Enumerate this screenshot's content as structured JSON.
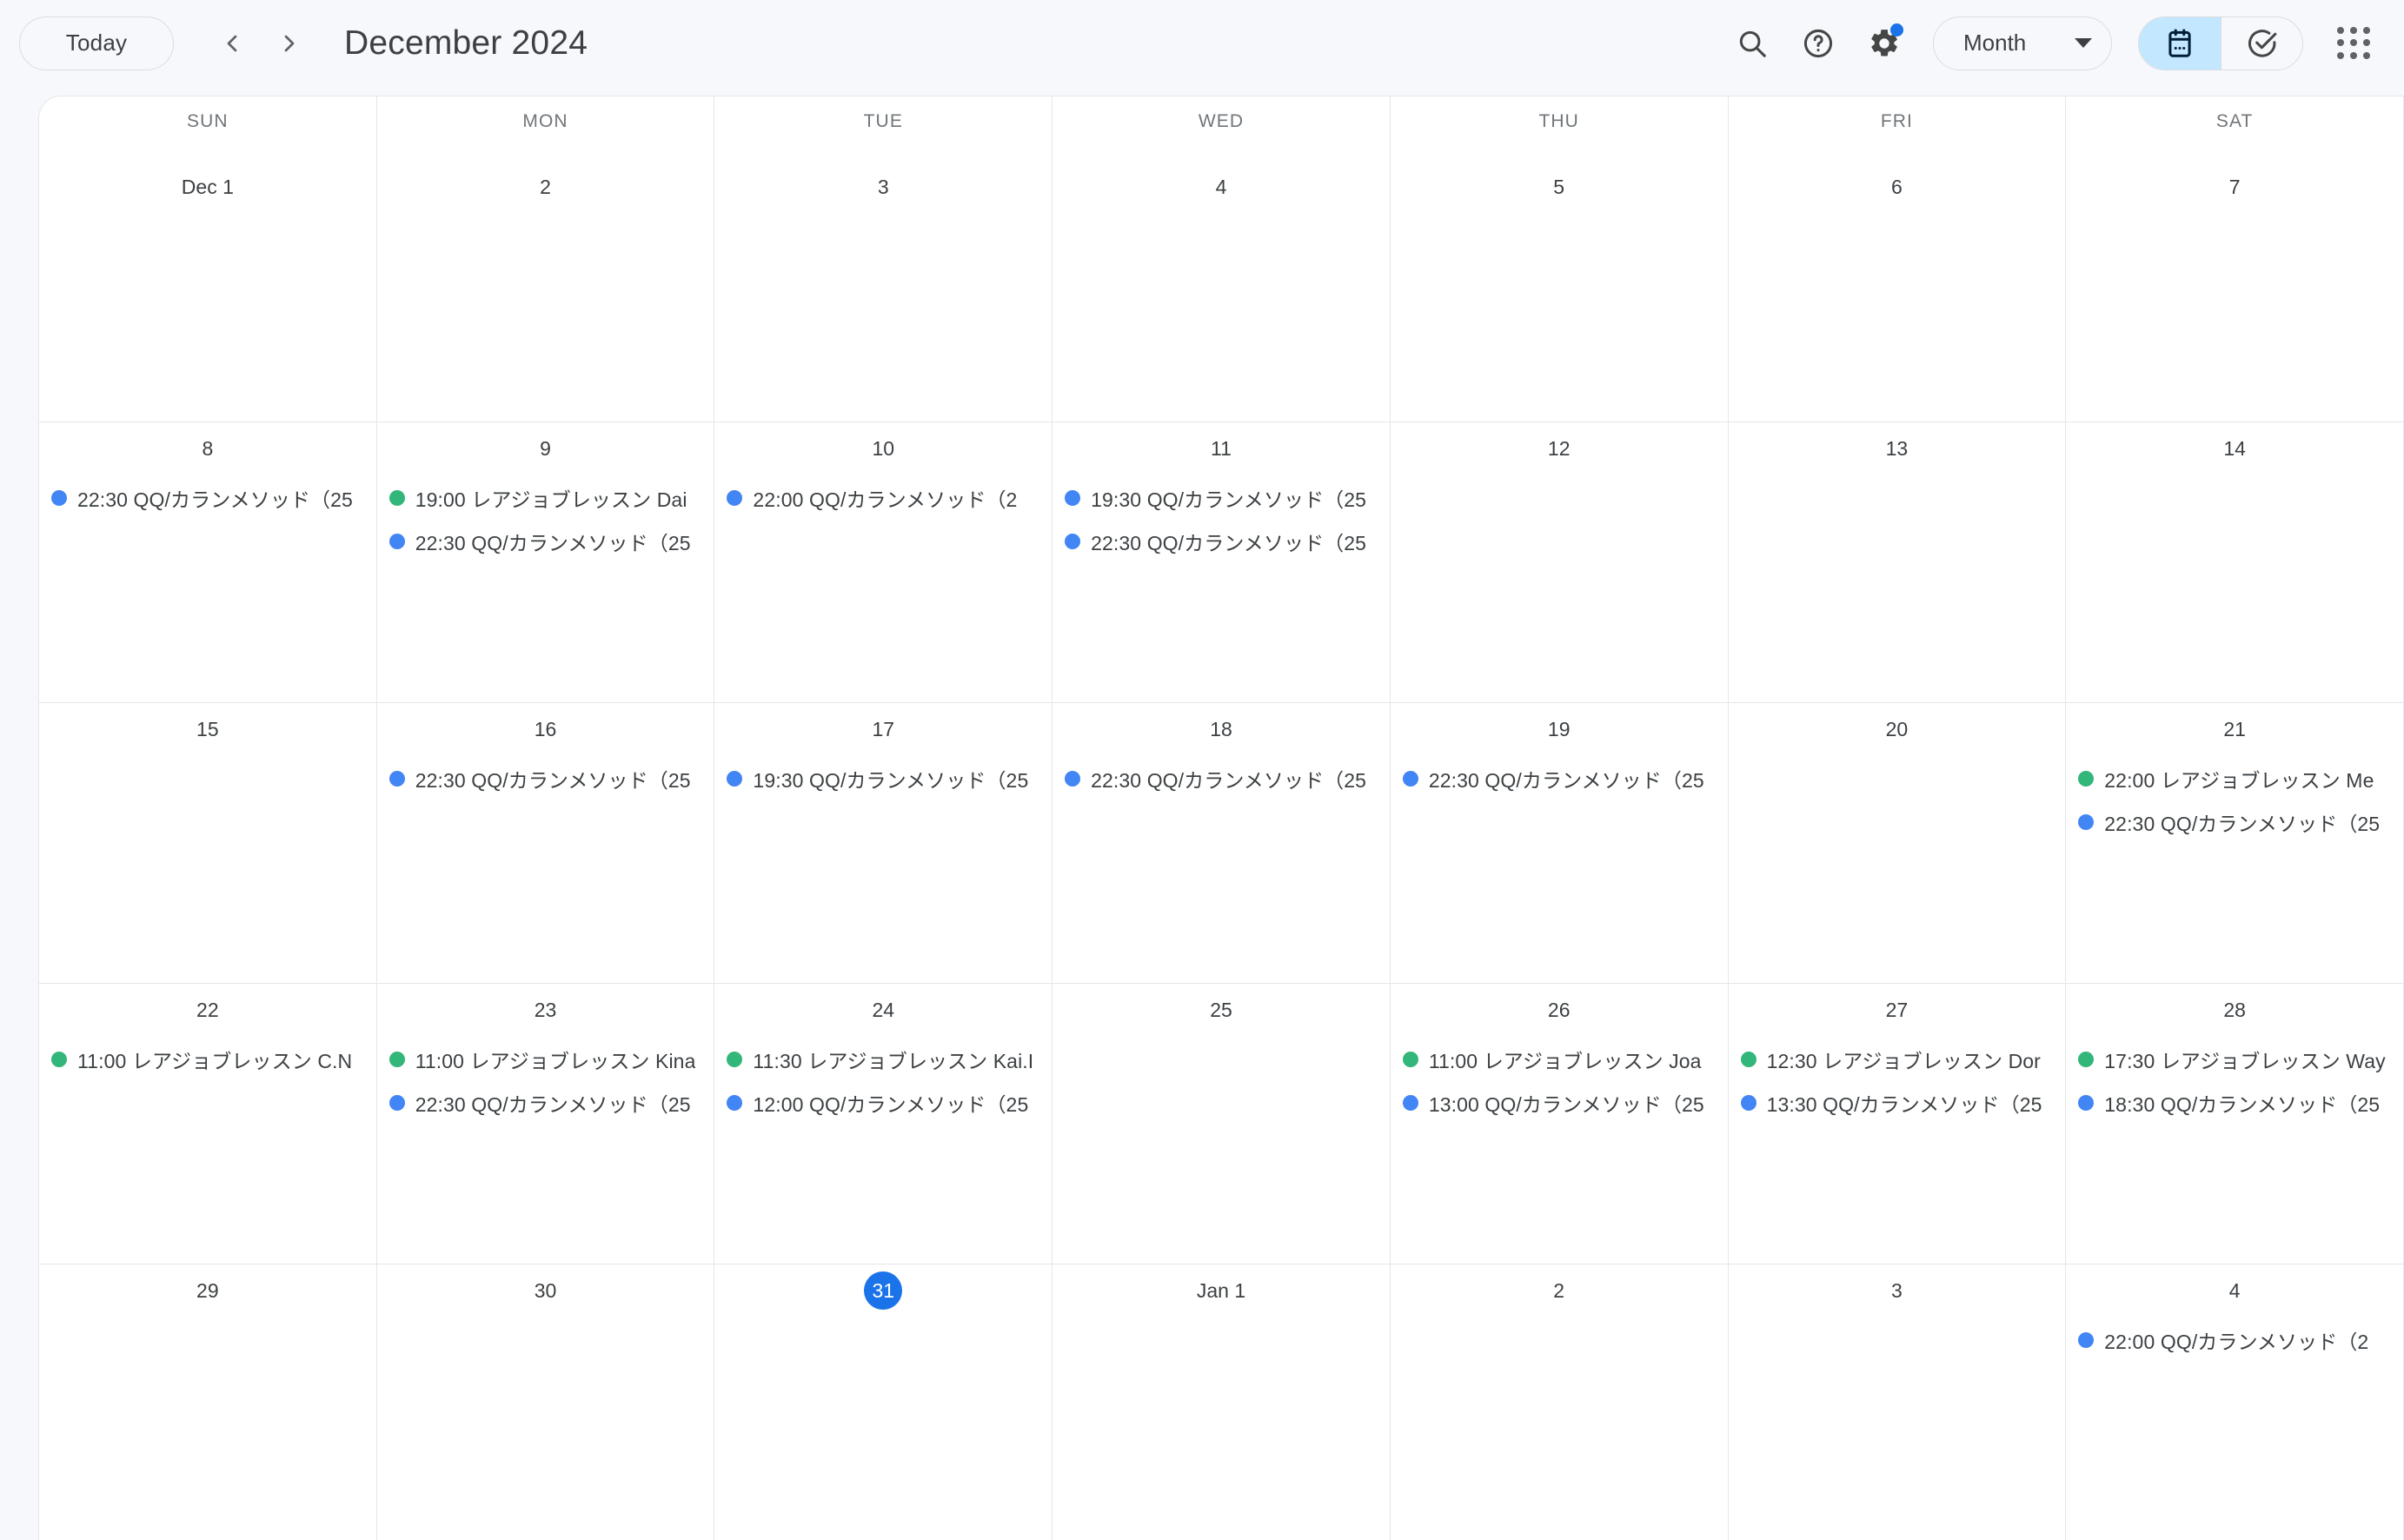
{
  "toolbar": {
    "today_label": "Today",
    "prev_label": "Previous period",
    "next_label": "Next period",
    "title": "December 2024",
    "search_label": "Search",
    "help_label": "Support",
    "settings_label": "Settings",
    "view_label": "Month",
    "calendar_mode_label": "Calendar view",
    "tasks_mode_label": "Tasks view",
    "apps_label": "Google apps"
  },
  "colors": {
    "event_blue": "#4285f4",
    "event_green": "#33b679",
    "today_blue": "#1a73e8",
    "toggle_active": "#c2e7ff",
    "page_bg": "#f6f8fc",
    "grid_line": "#e4e6e9"
  },
  "weekdays": [
    "SUN",
    "MON",
    "TUE",
    "WED",
    "THU",
    "FRI",
    "SAT"
  ],
  "weeks": [
    {
      "days": [
        {
          "label": "Dec 1",
          "today": false,
          "events": []
        },
        {
          "label": "2",
          "today": false,
          "events": []
        },
        {
          "label": "3",
          "today": false,
          "events": []
        },
        {
          "label": "4",
          "today": false,
          "events": []
        },
        {
          "label": "5",
          "today": false,
          "events": []
        },
        {
          "label": "6",
          "today": false,
          "events": []
        },
        {
          "label": "7",
          "today": false,
          "events": []
        }
      ]
    },
    {
      "days": [
        {
          "label": "8",
          "today": false,
          "events": [
            {
              "time": "22:30",
              "title": "QQ/カランメソッド（25",
              "color": "blue"
            }
          ]
        },
        {
          "label": "9",
          "today": false,
          "events": [
            {
              "time": "19:00",
              "title": "レアジョブレッスン Dai",
              "color": "green"
            },
            {
              "time": "22:30",
              "title": "QQ/カランメソッド（25",
              "color": "blue"
            }
          ]
        },
        {
          "label": "10",
          "today": false,
          "events": [
            {
              "time": "22:00",
              "title": "QQ/カランメソッド（2",
              "color": "blue"
            }
          ]
        },
        {
          "label": "11",
          "today": false,
          "events": [
            {
              "time": "19:30",
              "title": "QQ/カランメソッド（25",
              "color": "blue"
            },
            {
              "time": "22:30",
              "title": "QQ/カランメソッド（25",
              "color": "blue"
            }
          ]
        },
        {
          "label": "12",
          "today": false,
          "events": []
        },
        {
          "label": "13",
          "today": false,
          "events": []
        },
        {
          "label": "14",
          "today": false,
          "events": []
        }
      ]
    },
    {
      "days": [
        {
          "label": "15",
          "today": false,
          "events": []
        },
        {
          "label": "16",
          "today": false,
          "events": [
            {
              "time": "22:30",
              "title": "QQ/カランメソッド（25",
              "color": "blue"
            }
          ]
        },
        {
          "label": "17",
          "today": false,
          "events": [
            {
              "time": "19:30",
              "title": "QQ/カランメソッド（25",
              "color": "blue"
            }
          ]
        },
        {
          "label": "18",
          "today": false,
          "events": [
            {
              "time": "22:30",
              "title": "QQ/カランメソッド（25",
              "color": "blue"
            }
          ]
        },
        {
          "label": "19",
          "today": false,
          "events": [
            {
              "time": "22:30",
              "title": "QQ/カランメソッド（25",
              "color": "blue"
            }
          ]
        },
        {
          "label": "20",
          "today": false,
          "events": []
        },
        {
          "label": "21",
          "today": false,
          "events": [
            {
              "time": "22:00",
              "title": "レアジョブレッスン Me",
              "color": "green"
            },
            {
              "time": "22:30",
              "title": "QQ/カランメソッド（25",
              "color": "blue"
            }
          ]
        }
      ]
    },
    {
      "days": [
        {
          "label": "22",
          "today": false,
          "events": [
            {
              "time": "11:00",
              "title": "レアジョブレッスン C.N",
              "color": "green"
            }
          ]
        },
        {
          "label": "23",
          "today": false,
          "events": [
            {
              "time": "11:00",
              "title": "レアジョブレッスン Kina",
              "color": "green"
            },
            {
              "time": "22:30",
              "title": "QQ/カランメソッド（25",
              "color": "blue"
            }
          ]
        },
        {
          "label": "24",
          "today": false,
          "events": [
            {
              "time": "11:30",
              "title": "レアジョブレッスン Kai.I",
              "color": "green"
            },
            {
              "time": "12:00",
              "title": "QQ/カランメソッド（25",
              "color": "blue"
            }
          ]
        },
        {
          "label": "25",
          "today": false,
          "events": []
        },
        {
          "label": "26",
          "today": false,
          "events": [
            {
              "time": "11:00",
              "title": "レアジョブレッスン Joa",
              "color": "green"
            },
            {
              "time": "13:00",
              "title": "QQ/カランメソッド（25",
              "color": "blue"
            }
          ]
        },
        {
          "label": "27",
          "today": false,
          "events": [
            {
              "time": "12:30",
              "title": "レアジョブレッスン Dor",
              "color": "green"
            },
            {
              "time": "13:30",
              "title": "QQ/カランメソッド（25",
              "color": "blue"
            }
          ]
        },
        {
          "label": "28",
          "today": false,
          "events": [
            {
              "time": "17:30",
              "title": "レアジョブレッスン Way",
              "color": "green"
            },
            {
              "time": "18:30",
              "title": "QQ/カランメソッド（25",
              "color": "blue"
            }
          ]
        }
      ]
    },
    {
      "days": [
        {
          "label": "29",
          "today": false,
          "events": []
        },
        {
          "label": "30",
          "today": false,
          "events": []
        },
        {
          "label": "31",
          "today": true,
          "events": []
        },
        {
          "label": "Jan 1",
          "today": false,
          "events": []
        },
        {
          "label": "2",
          "today": false,
          "events": []
        },
        {
          "label": "3",
          "today": false,
          "events": []
        },
        {
          "label": "4",
          "today": false,
          "events": [
            {
              "time": "22:00",
              "title": "QQ/カランメソッド（2",
              "color": "blue"
            }
          ]
        }
      ]
    }
  ]
}
